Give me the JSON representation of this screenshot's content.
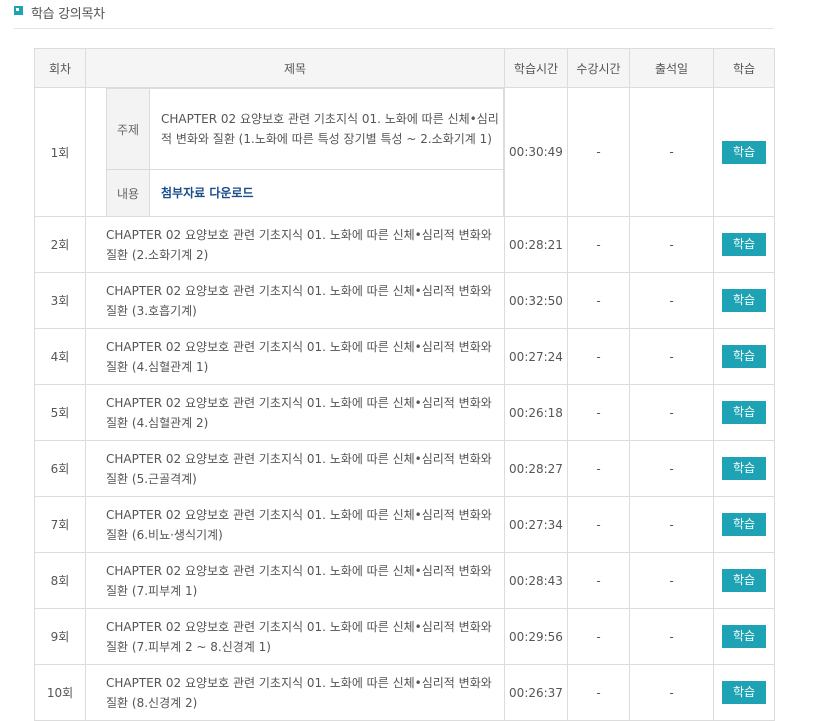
{
  "section": {
    "title": "학습 강의목차"
  },
  "table": {
    "headers": {
      "no": "회차",
      "title": "제목",
      "study_time": "학습시간",
      "watch_time": "수강시간",
      "attend_date": "출석일",
      "action": "학습"
    },
    "first": {
      "no": "1회",
      "label_title": "주제",
      "title": "CHAPTER 02 요양보호 관련 기초지식 01. 노화에 따른 신체•심리적 변화와 질환 (1.노화에 따른 특성 장기별 특성 ~ 2.소화기계 1)",
      "label_content": "내용",
      "download": "첨부자료 다운로드",
      "study_time": "00:30:49",
      "watch_time": "-",
      "attend_date": "-",
      "button": "학습"
    },
    "rows": [
      {
        "no": "2회",
        "title": "CHAPTER 02 요양보호 관련 기초지식 01. 노화에 따른 신체•심리적 변화와 질환 (2.소화기계 2)",
        "study_time": "00:28:21",
        "watch_time": "-",
        "attend_date": "-",
        "button": "학습"
      },
      {
        "no": "3회",
        "title": "CHAPTER 02 요양보호 관련 기초지식 01. 노화에 따른 신체•심리적 변화와 질환 (3.호흡기계)",
        "study_time": "00:32:50",
        "watch_time": "-",
        "attend_date": "-",
        "button": "학습"
      },
      {
        "no": "4회",
        "title": "CHAPTER 02 요양보호 관련 기초지식 01. 노화에 따른 신체•심리적 변화와 질환 (4.심혈관계 1)",
        "study_time": "00:27:24",
        "watch_time": "-",
        "attend_date": "-",
        "button": "학습"
      },
      {
        "no": "5회",
        "title": "CHAPTER 02 요양보호 관련 기초지식 01. 노화에 따른 신체•심리적 변화와 질환 (4.심혈관계 2)",
        "study_time": "00:26:18",
        "watch_time": "-",
        "attend_date": "-",
        "button": "학습"
      },
      {
        "no": "6회",
        "title": "CHAPTER 02 요양보호 관련 기초지식 01. 노화에 따른 신체•심리적 변화와 질환 (5.근골격계)",
        "study_time": "00:28:27",
        "watch_time": "-",
        "attend_date": "-",
        "button": "학습"
      },
      {
        "no": "7회",
        "title": "CHAPTER 02 요양보호 관련 기초지식 01. 노화에 따른 신체•심리적 변화와 질환 (6.비뇨·생식기계)",
        "study_time": "00:27:34",
        "watch_time": "-",
        "attend_date": "-",
        "button": "학습"
      },
      {
        "no": "8회",
        "title": "CHAPTER 02 요양보호 관련 기초지식 01. 노화에 따른 신체•심리적 변화와 질환 (7.피부계 1)",
        "study_time": "00:28:43",
        "watch_time": "-",
        "attend_date": "-",
        "button": "학습"
      },
      {
        "no": "9회",
        "title": "CHAPTER 02 요양보호 관련 기초지식 01. 노화에 따른 신체•심리적 변화와 질환 (7.피부계 2 ~ 8.신경계 1)",
        "study_time": "00:29:56",
        "watch_time": "-",
        "attend_date": "-",
        "button": "학습"
      },
      {
        "no": "10회",
        "title": "CHAPTER 02 요양보호 관련 기초지식 01. 노화에 따른 신체•심리적 변화와 질환 (8.신경계 2)",
        "study_time": "00:26:37",
        "watch_time": "-",
        "attend_date": "-",
        "button": "학습"
      }
    ]
  },
  "colors": {
    "accent": "#1ea3b5",
    "link": "#1a4d8c",
    "header_bg": "#f5f5f5",
    "border": "#dcdcdc"
  }
}
